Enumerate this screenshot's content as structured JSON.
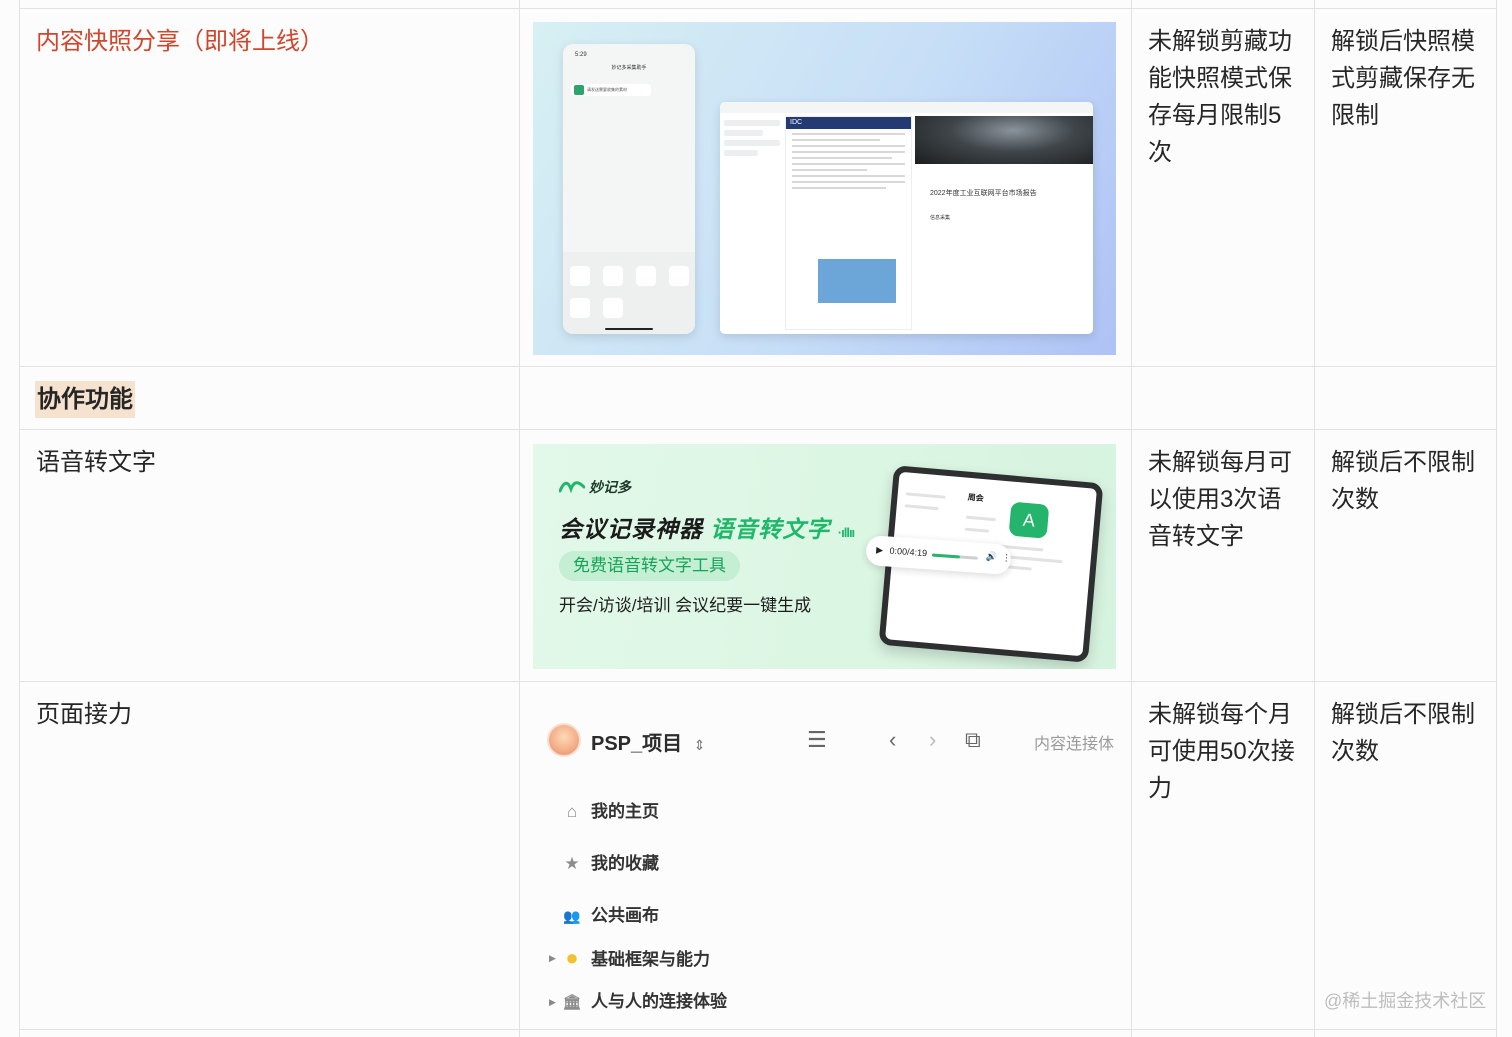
{
  "rows": [
    {
      "feature": "内容快照分享（即将上线）",
      "locked": "未解锁剪藏功能快照模式保存每月限制5次",
      "unlocked": "解锁后快照模式剪藏保存无限制",
      "highlight_color": "#d1452b"
    },
    {
      "feature": "协作功能",
      "section_header": true,
      "badge_color": "#f6e3cf"
    },
    {
      "feature": "语音转文字",
      "locked": "未解锁每月可以使用3次语音转文字",
      "unlocked": "解锁后不限制次数"
    },
    {
      "feature": "页面接力",
      "locked": "未解锁每个月可使用50次接力",
      "unlocked": "解锁后不限制次数"
    }
  ],
  "snapshot_image": {
    "phone_time": "5:29",
    "phone_title": "妙记多采集助手",
    "phone_chip": "请发送需要收集的素材",
    "doc_brand": "IDC",
    "report_title": "2022年度工业互联网平台市场报告",
    "info_label": "信息采集"
  },
  "voice_banner": {
    "brand": "妙记多",
    "title": "会议记录神器",
    "title_highlight": "语音转文字",
    "pill": "免费语音转文字工具",
    "desc": "开会/访谈/培训 会议纪要一键生成",
    "player_time": "0:00/4:19",
    "tablet_heading": "周会",
    "accent": "#1fb86a"
  },
  "relay_sidebar": {
    "project": "PSP_项目",
    "relay_label": "内容连接体",
    "nav": [
      {
        "icon": "home-icon",
        "glyph": "⌂",
        "label": "我的主页"
      },
      {
        "icon": "star-icon",
        "glyph": "★",
        "label": "我的收藏"
      },
      {
        "icon": "people-icon",
        "glyph": "👥",
        "label": "公共画布"
      },
      {
        "icon": "yellow-circle-icon",
        "glyph": "●",
        "label": "基础框架与能力",
        "expandable": true
      },
      {
        "icon": "building-icon",
        "glyph": "🏛",
        "label": "人与人的连接体验",
        "expandable": true
      }
    ]
  },
  "watermark": "@稀土掘金技术社区"
}
